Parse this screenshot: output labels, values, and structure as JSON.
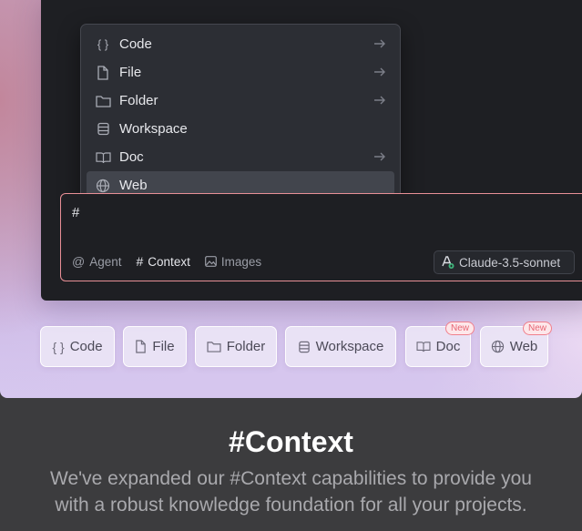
{
  "menu": {
    "items": [
      {
        "label": "Code",
        "icon": "braces-icon",
        "has_arrow": true
      },
      {
        "label": "File",
        "icon": "file-icon",
        "has_arrow": true
      },
      {
        "label": "Folder",
        "icon": "folder-icon",
        "has_arrow": true
      },
      {
        "label": "Workspace",
        "icon": "workspace-icon",
        "has_arrow": false
      },
      {
        "label": "Doc",
        "icon": "book-icon",
        "has_arrow": true
      },
      {
        "label": "Web",
        "icon": "globe-icon",
        "has_arrow": false,
        "selected": true
      }
    ]
  },
  "input": {
    "value": "#",
    "tools": {
      "agent_symbol": "@",
      "agent": "Agent",
      "context_symbol": "#",
      "context": "Context",
      "images": "Images"
    },
    "model": "Claude-3.5-sonnet"
  },
  "chips": [
    {
      "label": "Code",
      "icon": "braces-icon"
    },
    {
      "label": "File",
      "icon": "file-icon"
    },
    {
      "label": "Folder",
      "icon": "folder-icon"
    },
    {
      "label": "Workspace",
      "icon": "workspace-icon"
    },
    {
      "label": "Doc",
      "icon": "book-icon",
      "badge": "New"
    },
    {
      "label": "Web",
      "icon": "globe-icon",
      "badge": "New"
    }
  ],
  "headline": "#Context",
  "description_line1": "We've expanded our #Context capabilities to provide you",
  "description_line2": "with a robust knowledge foundation for all your projects.",
  "colors": {
    "accent_border": "#e88f96",
    "badge": "#e86573",
    "editor_bg": "#1e1f23",
    "footer_bg": "#3c3c3e"
  }
}
